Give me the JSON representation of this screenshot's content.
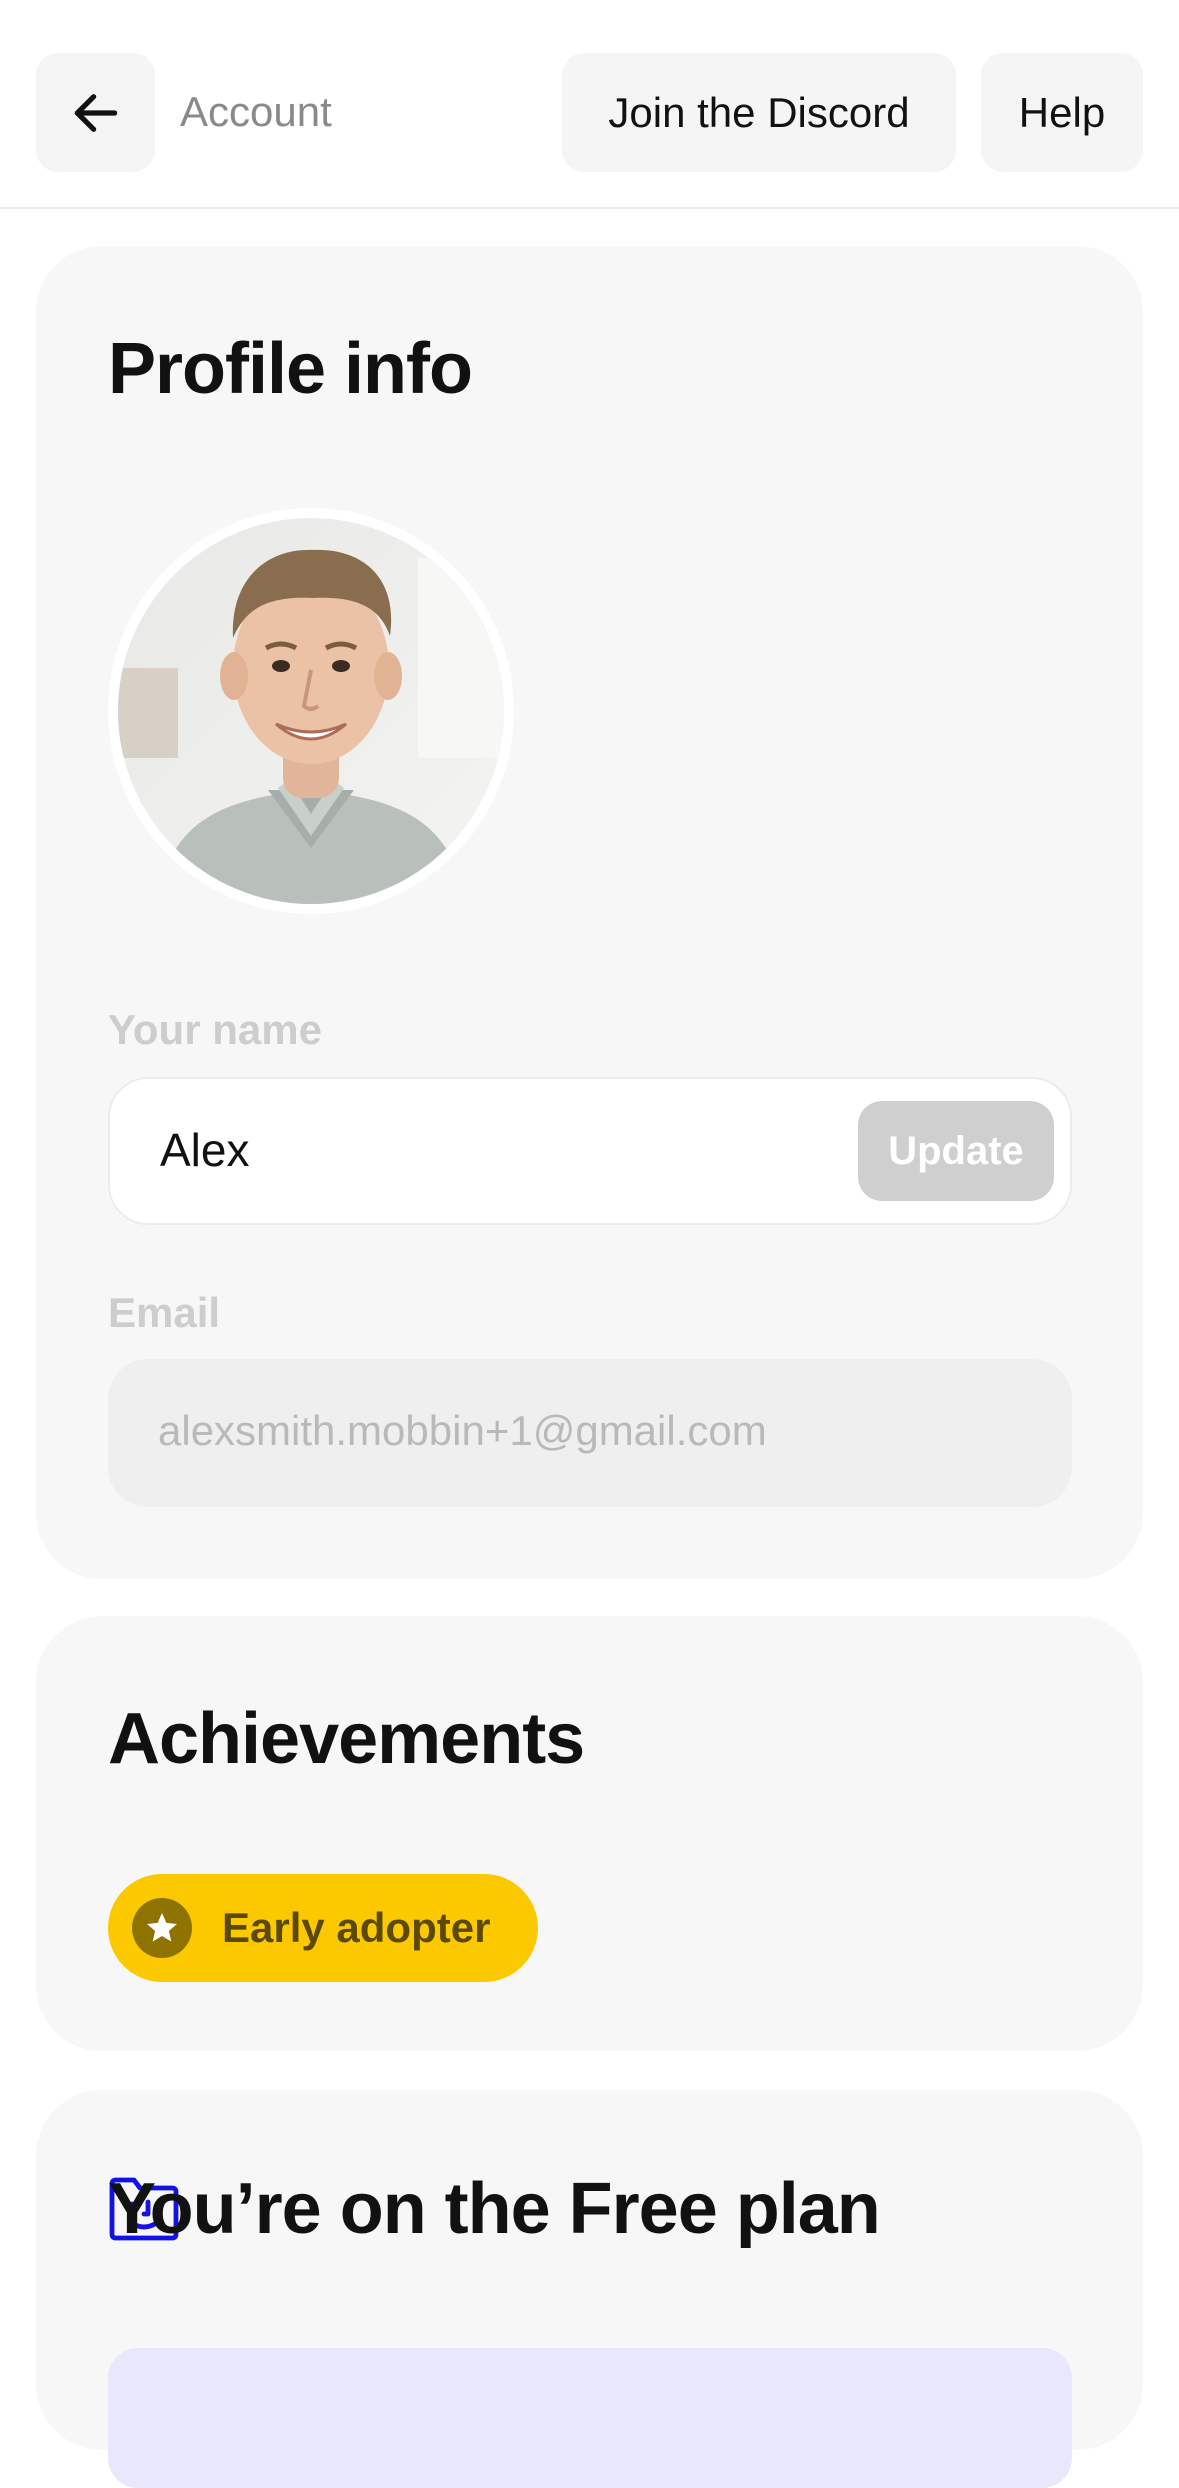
{
  "header": {
    "back_icon": "arrow-left-icon",
    "title": "Account",
    "discord_label": "Join the Discord",
    "help_label": "Help"
  },
  "profile": {
    "heading": "Profile info",
    "name_label": "Your name",
    "name_value": "Alex",
    "update_label": "Update",
    "email_label": "Email",
    "email_value": "alexsmith.mobbin+1@gmail.com"
  },
  "achievements": {
    "heading": "Achievements",
    "badge_label": "Early adopter",
    "badge_icon": "star-icon",
    "badge_color": "#fcc800"
  },
  "plan": {
    "icon": "smiley-folder-icon",
    "title": "You’re on the Free plan",
    "accent_color": "#1212e6"
  }
}
